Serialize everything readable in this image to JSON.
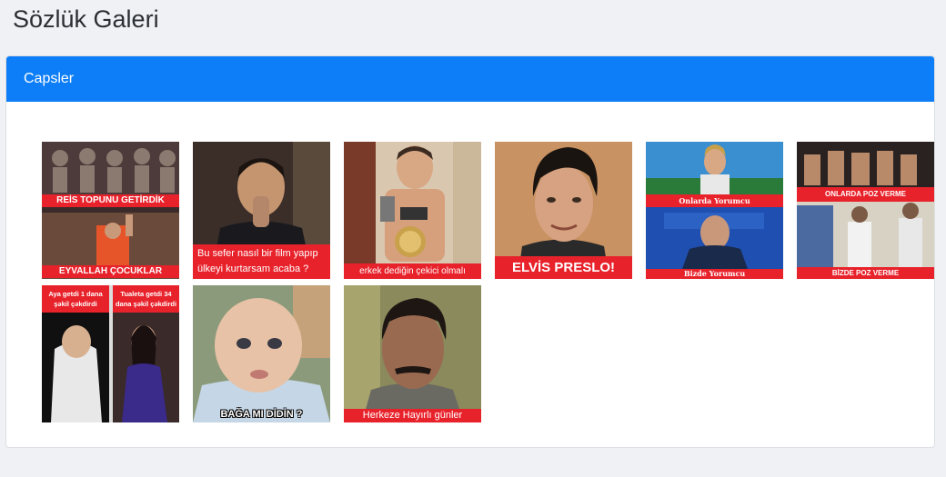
{
  "page": {
    "title": "Sözlük Galeri"
  },
  "card": {
    "header": "Capsler"
  },
  "gallery": {
    "items": [
      {
        "captions": [
          "REİS TOPUNU GETİRDİK",
          "EYVALLAH ÇOCUKLAR"
        ]
      },
      {
        "captions": [
          "Bu sefer nasıl bir film yapıp",
          "ülkeyi kurtarsam acaba ?"
        ]
      },
      {
        "captions": [
          "erkek dediğin çekici olmalı"
        ]
      },
      {
        "captions": [
          "ELVİS PRESLO!"
        ]
      },
      {
        "captions": [
          "Onlarda Yorumcu",
          "Bizde Yorumcu"
        ]
      },
      {
        "captions": [
          "ONLARDA POZ VERME",
          "BİZDE POZ VERME"
        ]
      },
      {
        "captions": [
          "Aya getdi 1 dana",
          "şəkil çəkdirdi",
          "Tualeta getdi 34",
          "dana şəkil çəkdirdi"
        ]
      },
      {
        "captions": [
          "BAĞA MI DİDİN ?"
        ]
      },
      {
        "captions": [
          "Herkeze Hayırlı günler"
        ]
      }
    ]
  }
}
